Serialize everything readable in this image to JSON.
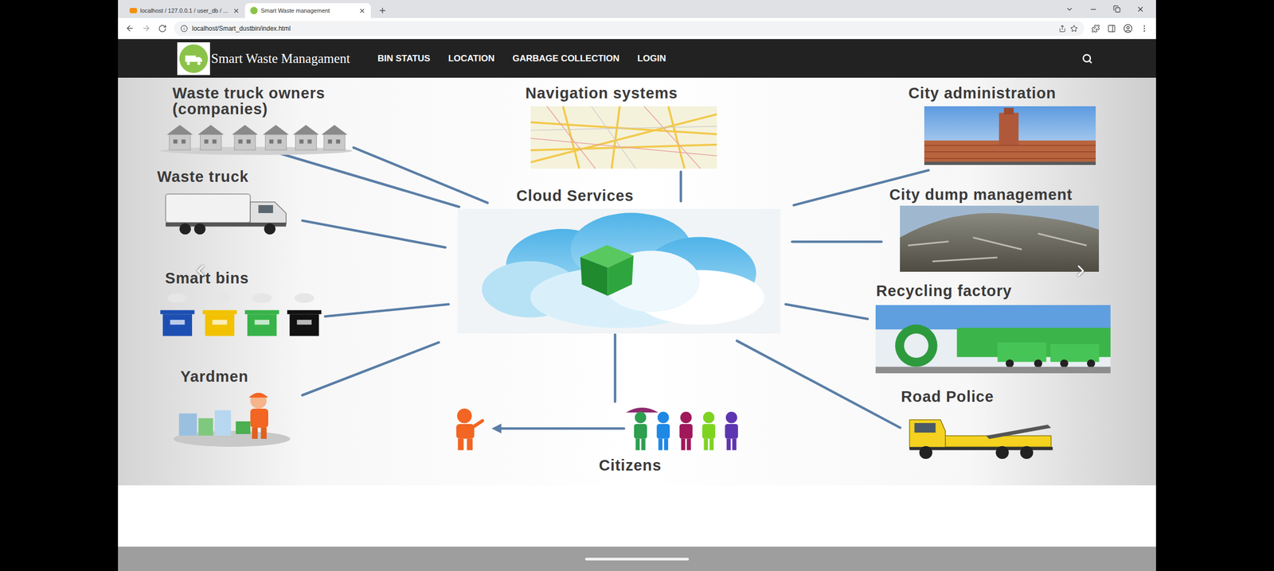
{
  "browser": {
    "tabs": [
      {
        "label": "localhost / 127.0.0.1 / user_db / ...",
        "selected": false
      },
      {
        "label": "Smart Waste management",
        "selected": true
      }
    ],
    "address": "localhost/Smart_dustbin/index.html"
  },
  "navbar": {
    "brand": "Smart Waste Managament",
    "links": [
      "BIN STATUS",
      "LOCATION",
      "GARBAGE COLLECTION",
      "LOGIN"
    ]
  },
  "diagram": {
    "center": "Cloud Services",
    "nodes": [
      {
        "label": "Waste truck owners (companies)",
        "kind": "owners"
      },
      {
        "label": "Navigation systems",
        "kind": "navigation"
      },
      {
        "label": "City administration",
        "kind": "admin"
      },
      {
        "label": "Waste truck",
        "kind": "truck"
      },
      {
        "label": "City dump management",
        "kind": "dump"
      },
      {
        "label": "Smart bins",
        "kind": "bins"
      },
      {
        "label": "Recycling factory",
        "kind": "recycling"
      },
      {
        "label": "Yardmen",
        "kind": "yardmen"
      },
      {
        "label": "Road Police",
        "kind": "police"
      },
      {
        "label": "Citizens",
        "kind": "citizens"
      }
    ]
  }
}
